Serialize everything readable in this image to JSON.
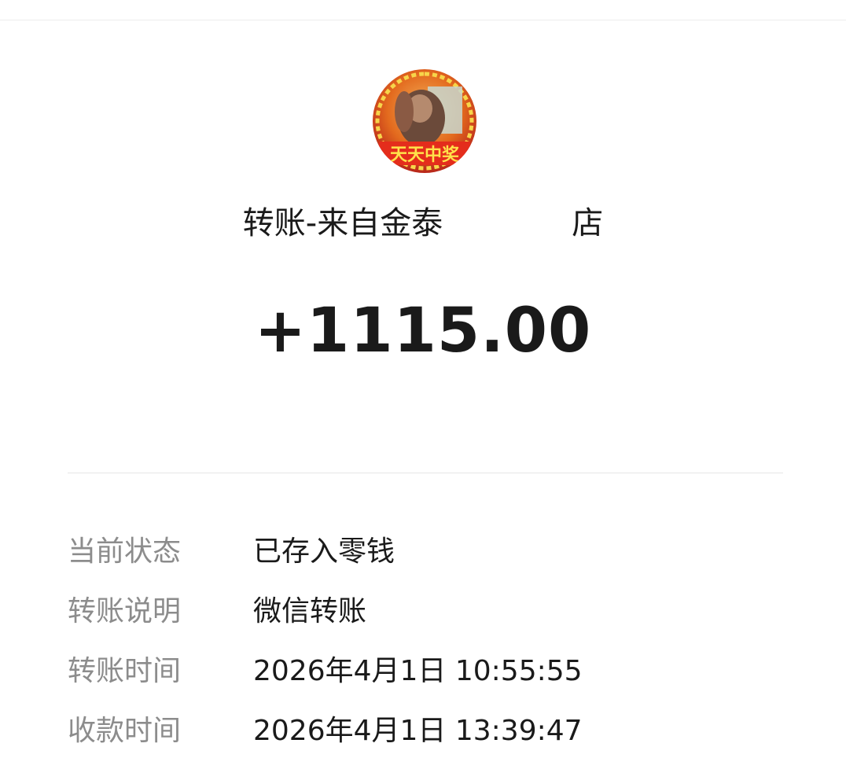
{
  "transfer": {
    "title_prefix": "转账-来自金泰",
    "title_suffix": "店",
    "amount": "+1115.00"
  },
  "details": [
    {
      "label": "当前状态",
      "value": "已存入零钱"
    },
    {
      "label": "转账说明",
      "value": "微信转账"
    },
    {
      "label": "转账时间",
      "value": "2026年4月1日 10:55:55"
    },
    {
      "label": "收款时间",
      "value": "2026年4月1日 13:39:47"
    }
  ],
  "avatar": {
    "icon": "user-avatar-photo",
    "badge_text": "天天中奖"
  },
  "colors": {
    "text_primary": "#1a1a1a",
    "text_secondary": "#8c8c8c",
    "divider": "#e6e6e6"
  }
}
